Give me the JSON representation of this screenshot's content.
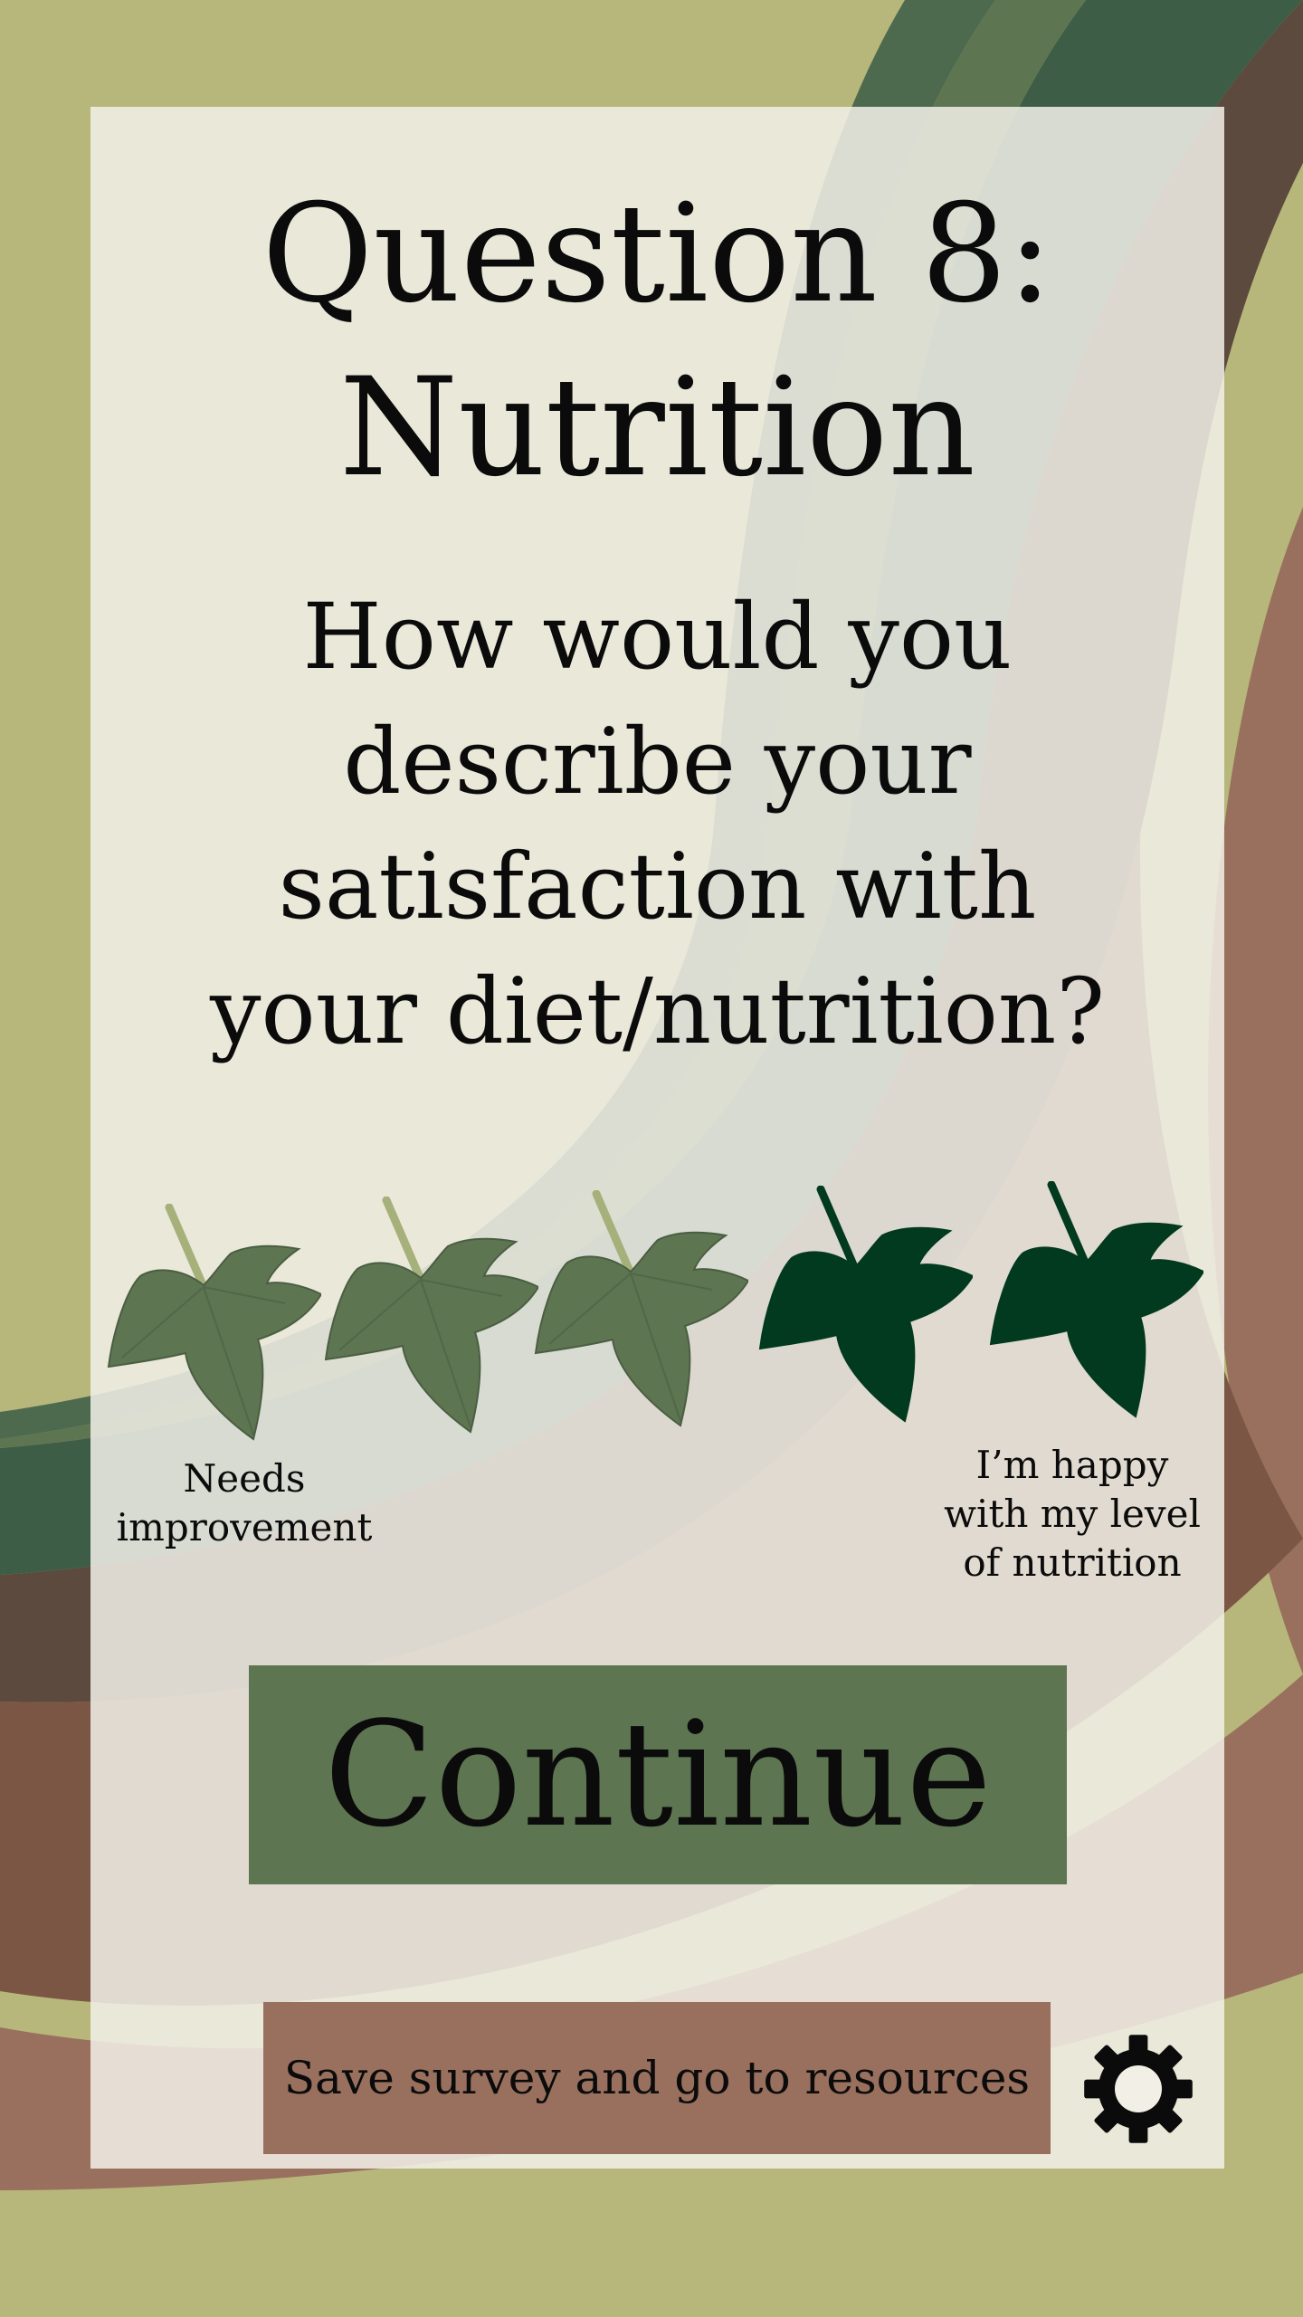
{
  "survey": {
    "title_lines": [
      "Question 8:",
      "Nutrition"
    ],
    "question": "How would you describe your satisfaction with your diet/nutrition?",
    "rating": {
      "max": 5,
      "selected": 2,
      "low_label": "Needs improvement",
      "high_label": "I’m happy with my level of nutrition"
    }
  },
  "actions": {
    "continue_label": "Continue",
    "resources_label": "Save survey and go to resources",
    "settings_icon": "gear-icon"
  },
  "icons": {
    "leaf": "leaf-icon",
    "settings": "gear-icon"
  },
  "colors": {
    "background": "#b7b67b",
    "leaf_unselected": "#5e7552",
    "leaf_selected": "#013a1e",
    "continue_button": "#5e7552",
    "resources_button": "#99705e"
  }
}
